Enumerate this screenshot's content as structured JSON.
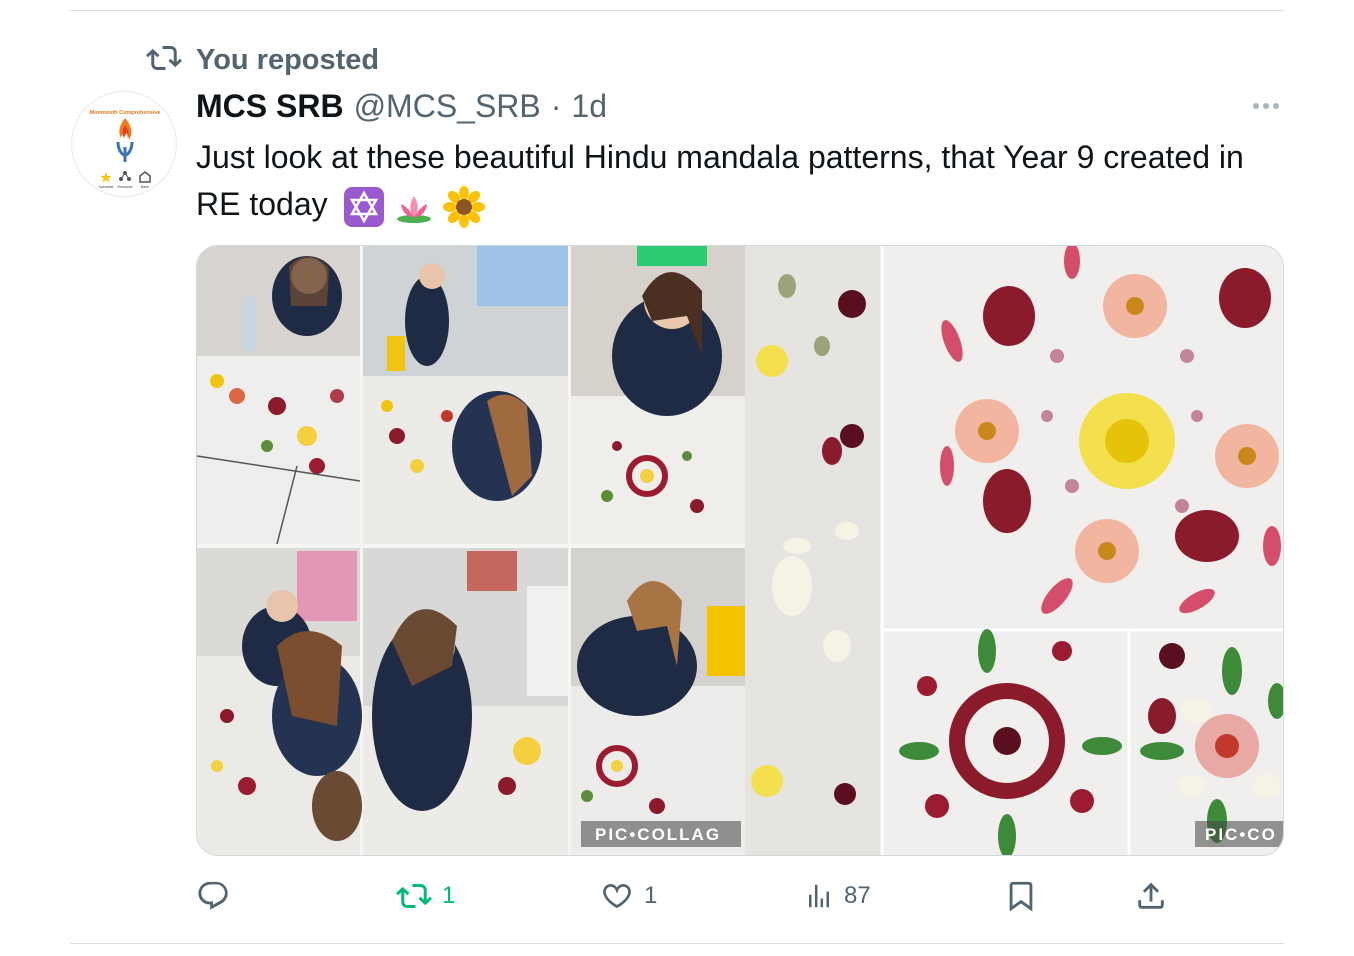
{
  "repost_banner": {
    "label": "You reposted"
  },
  "author": {
    "name": "MCS SRB",
    "handle": "@MCS_SRB",
    "separator": "·",
    "time": "1d"
  },
  "avatar": {
    "org_name": "Monmouth Comprehensive",
    "tags": [
      "Specialist",
      "Resource",
      "Base"
    ]
  },
  "tweet": {
    "text": "Just look at these beautiful Hindu mandala patterns, that Year 9 created in RE today",
    "emojis": [
      "star-of-david-icon",
      "lotus-icon",
      "sunflower-icon"
    ]
  },
  "media": {
    "collage_left_watermark": "PIC•COLLAG",
    "collage_right_watermark": "PIC•CO"
  },
  "actions": {
    "reply": {
      "count": ""
    },
    "repost": {
      "count": "1",
      "active": true
    },
    "like": {
      "count": "1"
    },
    "views": {
      "count": "87"
    },
    "bookmark": {
      "count": ""
    },
    "share": {
      "count": ""
    }
  },
  "colors": {
    "text_primary": "#0f1419",
    "text_secondary": "#536471",
    "repost_green": "#00ba7c",
    "divider": "#d9dde1"
  }
}
